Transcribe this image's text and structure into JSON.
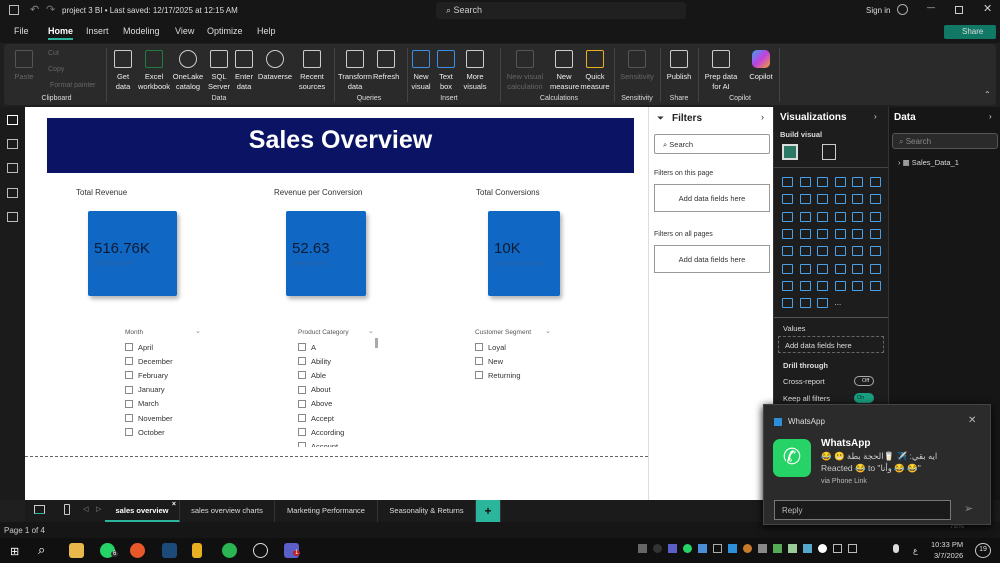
{
  "titlebar": {
    "title": "project 3 BI • Last saved: 12/17/2025 at 12:15 AM",
    "search": "Search",
    "sign_in": "Sign in"
  },
  "menu": [
    "File",
    "Home",
    "Insert",
    "Modeling",
    "View",
    "Optimize",
    "Help"
  ],
  "share": "Share",
  "ribbon": {
    "clipboard": {
      "paste": "Paste",
      "cut": "Cut",
      "copy": "Copy",
      "format_painter": "Format painter",
      "group": "Clipboard"
    },
    "data": {
      "items": [
        "Get data",
        "Excel workbook",
        "OneLake catalog",
        "SQL Server",
        "Enter data",
        "Dataverse",
        "Recent sources"
      ],
      "group": "Data"
    },
    "queries": {
      "items": [
        "Transform data",
        "Refresh"
      ],
      "group": "Queries"
    },
    "insert": {
      "items": [
        "New visual",
        "Text box",
        "More visuals"
      ],
      "group": "Insert"
    },
    "calculations": {
      "items": [
        "New visual calculation",
        "New measure",
        "Quick measure"
      ],
      "group": "Calculations"
    },
    "sensitivity": {
      "items": [
        "Sensitivity"
      ],
      "group": "Sensitivity"
    },
    "share": {
      "items": [
        "Publish"
      ],
      "group": "Share"
    },
    "copilot": {
      "items": [
        "Prep data for AI",
        "Copilot"
      ],
      "group": "Copilot"
    }
  },
  "report": {
    "title": "Sales Overview",
    "kpis": [
      {
        "label": "Total Revenue",
        "value": "516.76K",
        "sub": "Total Revenue"
      },
      {
        "label": "Revenue per Conversion",
        "value": "52.63",
        "sub": "Revenue per..."
      },
      {
        "label": "Total Conversions",
        "value": "10K",
        "sub": "Total Conversions"
      }
    ],
    "slicers": [
      {
        "title": "Month",
        "items": [
          "April",
          "December",
          "February",
          "January",
          "March",
          "November",
          "October"
        ]
      },
      {
        "title": "Product Category",
        "items": [
          "A",
          "Ability",
          "Able",
          "About",
          "Above",
          "Accept",
          "According",
          "Account"
        ]
      },
      {
        "title": "Customer Segment",
        "items": [
          "Loyal",
          "New",
          "Returning"
        ]
      }
    ]
  },
  "filters": {
    "title": "Filters",
    "search": "Search",
    "on_page": "Filters on this page",
    "on_all": "Filters on all pages",
    "add": "Add data fields here"
  },
  "viz": {
    "title": "Visualizations",
    "build": "Build visual",
    "values": "Values",
    "add": "Add data fields here",
    "drill": "Drill through",
    "cross": "Cross-report",
    "cross_state": "Off",
    "keep": "Keep all filters",
    "keep_state": "On",
    "more": "..."
  },
  "data_pane": {
    "title": "Data",
    "search": "Search",
    "table": "Sales_Data_1"
  },
  "tabs": [
    "sales overview",
    "sales overview charts",
    "Marketing Performance",
    "Seasonality & Returns"
  ],
  "status": "Page 1 of 4",
  "zoom": "78%",
  "clock": {
    "time": "10:33 PM",
    "date": "3/7/2026",
    "notifications": "19",
    "lang": "ع"
  },
  "taskbar_badges": {
    "whatsapp": "6",
    "teams": "1"
  },
  "notification": {
    "app": "WhatsApp",
    "title": "WhatsApp",
    "line1": "😂 😬 ايه بقي: ✈️ 🥛الحجة بطة",
    "line2": "Reacted 😂 to \"وأنا 😂 😂\"",
    "via": "via Phone Link",
    "reply": "Reply"
  },
  "colors": {
    "banner": "#0b1464",
    "card": "#1068c4",
    "accent": "#117865"
  }
}
